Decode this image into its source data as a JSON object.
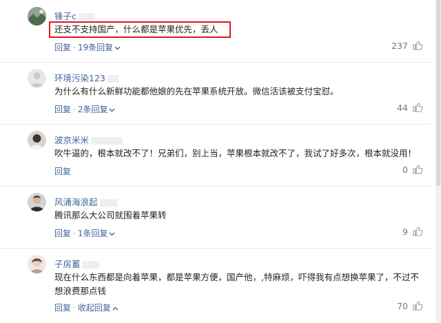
{
  "comments": [
    {
      "username": "锋子c",
      "text": "还支不支持国产，什么都是苹果优先，丢人",
      "reply_label": "回复",
      "sub_label": "19条回复",
      "likes": "237",
      "avatar_icon": "landscape-avatar-icon",
      "highlighted": true
    },
    {
      "username": "环境污染123",
      "text": "为什么有什么新鲜功能都他娘的先在苹果系统开放。微信活该被支付宝怼。",
      "reply_label": "回复",
      "sub_label": "2条回复",
      "likes": "44",
      "avatar_icon": "default-avatar-icon"
    },
    {
      "username": "波京米米",
      "text": "吹牛逼的，根本就改不了！兄弟们，别上当，苹果根本就改不了，我试了好多次，根本就没用！",
      "reply_label": "回复",
      "sub_label": "",
      "likes": "0",
      "avatar_icon": "person-avatar-icon"
    },
    {
      "username": "风涌海浪起",
      "text": "腾讯那么大公司就围着苹果转",
      "reply_label": "回复",
      "sub_label": "1条回复",
      "likes": "9",
      "avatar_icon": "person-avatar-icon"
    },
    {
      "username": "子房蓄",
      "text": "现在什么东西都是向着苹果，都是苹果方便，国产他，,特麻烦，吓得我有点想换苹果了，不过不想浪费那点钱",
      "reply_label": "回复",
      "sub_label": "收起回复",
      "likes": "70",
      "avatar_icon": "person-avatar-icon"
    }
  ],
  "colors": {
    "link": "#406599",
    "text": "#222222",
    "highlight": "#e0141e",
    "muted": "#777777"
  }
}
